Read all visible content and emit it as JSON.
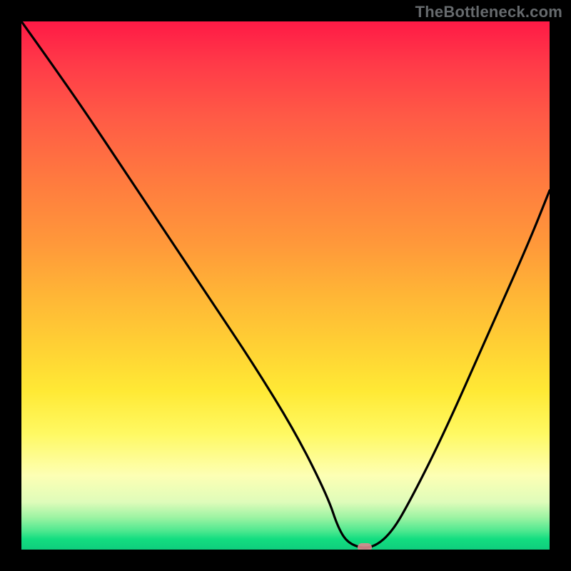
{
  "watermark": "TheBottleneck.com",
  "chart_data": {
    "type": "line",
    "title": "",
    "xlabel": "",
    "ylabel": "",
    "xlim": [
      0,
      100
    ],
    "ylim": [
      0,
      100
    ],
    "grid": false,
    "legend": false,
    "annotations": [],
    "background_gradient_stops": [
      {
        "pct": 0,
        "color": "#ff1a46"
      },
      {
        "pct": 8,
        "color": "#ff3a48"
      },
      {
        "pct": 18,
        "color": "#ff5a46"
      },
      {
        "pct": 30,
        "color": "#ff7a3f"
      },
      {
        "pct": 42,
        "color": "#ff983a"
      },
      {
        "pct": 52,
        "color": "#ffb636"
      },
      {
        "pct": 62,
        "color": "#ffd234"
      },
      {
        "pct": 70,
        "color": "#ffe935"
      },
      {
        "pct": 78,
        "color": "#fff962"
      },
      {
        "pct": 86,
        "color": "#fdffb4"
      },
      {
        "pct": 91,
        "color": "#dffcba"
      },
      {
        "pct": 94,
        "color": "#9af3a2"
      },
      {
        "pct": 96.5,
        "color": "#4de88f"
      },
      {
        "pct": 98,
        "color": "#13dd80"
      },
      {
        "pct": 100,
        "color": "#0fce7d"
      }
    ],
    "series": [
      {
        "name": "bottleneck-curve",
        "x": [
          0,
          5,
          12,
          20,
          28,
          36,
          44,
          52,
          58,
          60,
          62,
          66,
          70,
          74,
          80,
          88,
          96,
          100
        ],
        "values": [
          100,
          93,
          83,
          71,
          59,
          47,
          35,
          22,
          10,
          4,
          1,
          0,
          3,
          10,
          22,
          40,
          58,
          68
        ]
      }
    ],
    "marker": {
      "x": 65,
      "y": 0,
      "color": "#d98a8f",
      "shape": "pill"
    }
  }
}
